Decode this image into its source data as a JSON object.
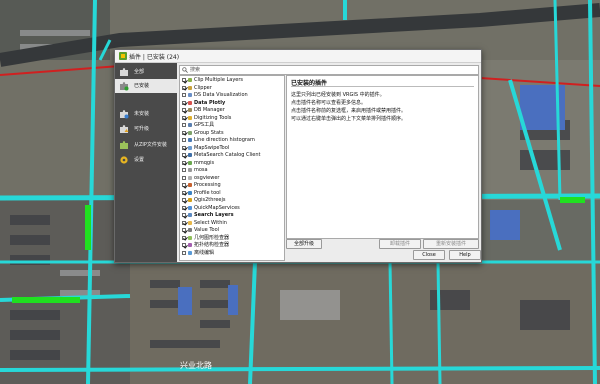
{
  "dialog": {
    "title": "插件 | 已安装 (24)"
  },
  "sidebar": {
    "items": [
      {
        "label": "全部",
        "icon": "puzzle-icon"
      },
      {
        "label": "已安装",
        "icon": "puzzle-installed-icon"
      },
      {
        "label": "未安装",
        "icon": "puzzle-not-installed-icon"
      },
      {
        "label": "可升级",
        "icon": "puzzle-upgradeable-icon"
      },
      {
        "label": "从ZIP文件安装",
        "icon": "zip-install-icon"
      },
      {
        "label": "设置",
        "icon": "gear-icon"
      }
    ]
  },
  "search": {
    "placeholder": "搜索"
  },
  "plugins": [
    {
      "name": "Clip Multiple Layers",
      "checked": true,
      "bold": false,
      "color": "#8ab04a"
    },
    {
      "name": "Clipper",
      "checked": true,
      "bold": false,
      "color": "#c9a23b"
    },
    {
      "name": "DS Data Visualization",
      "checked": false,
      "bold": false,
      "color": "#6a8fc7"
    },
    {
      "name": "Data Plotly",
      "checked": true,
      "bold": true,
      "color": "#d9534f"
    },
    {
      "name": "DB Manager",
      "checked": true,
      "bold": false,
      "color": "#9b8a5a"
    },
    {
      "name": "Digitizing Tools",
      "checked": true,
      "bold": false,
      "color": "#e0b02c"
    },
    {
      "name": "GPS工具",
      "checked": false,
      "bold": false,
      "color": "#5a7fb0"
    },
    {
      "name": "Group Stats",
      "checked": true,
      "bold": false,
      "color": "#7fa36a"
    },
    {
      "name": "Line direction histogram",
      "checked": false,
      "bold": false,
      "color": "#4a7ab5"
    },
    {
      "name": "MapSwipeTool",
      "checked": true,
      "bold": false,
      "color": "#6b9bd1"
    },
    {
      "name": "MetaSearch Catalog Client",
      "checked": true,
      "bold": false,
      "color": "#3f6fa8"
    },
    {
      "name": "mmqgis",
      "checked": true,
      "bold": false,
      "color": "#6aa84f"
    },
    {
      "name": "mosa",
      "checked": false,
      "bold": false,
      "color": "#999999"
    },
    {
      "name": "osgviewer",
      "checked": false,
      "bold": false,
      "color": "#b0b0b0"
    },
    {
      "name": "Processing",
      "checked": true,
      "bold": false,
      "color": "#c7612e"
    },
    {
      "name": "Profile tool",
      "checked": true,
      "bold": false,
      "color": "#3b83c4"
    },
    {
      "name": "Qgis2threejs",
      "checked": true,
      "bold": false,
      "color": "#d4a017"
    },
    {
      "name": "QuickMapServices",
      "checked": true,
      "bold": false,
      "color": "#4f8fd6"
    },
    {
      "name": "Search Layers",
      "checked": true,
      "bold": true,
      "color": "#5c8ac2"
    },
    {
      "name": "Select Within",
      "checked": true,
      "bold": false,
      "color": "#e8b84a"
    },
    {
      "name": "Value Tool",
      "checked": true,
      "bold": false,
      "color": "#7a7a7a"
    },
    {
      "name": "几何图形检查器",
      "checked": true,
      "bold": false,
      "color": "#8fbf5a"
    },
    {
      "name": "拓扑结构检查器",
      "checked": true,
      "bold": false,
      "color": "#a45fb0"
    },
    {
      "name": "离线编辑",
      "checked": false,
      "bold": false,
      "color": "#5a9ad6"
    }
  ],
  "details": {
    "heading": "已安装的插件",
    "lines": [
      "这里只列出已经安装到 VRGIS 中的插件。",
      "点击插件名称可以查看更多信息。",
      "点击插件名称前的复选框，来启用插件或禁用插件。",
      "可以通过右键单击弹出的上下文菜单排列插件顺序。"
    ]
  },
  "buttons": {
    "upgrade_all": "全部升级",
    "uninstall": "卸载插件",
    "reinstall": "重新安装插件",
    "close": "Close",
    "help": "Help"
  },
  "map_labels": {
    "street": "兴业北路"
  }
}
